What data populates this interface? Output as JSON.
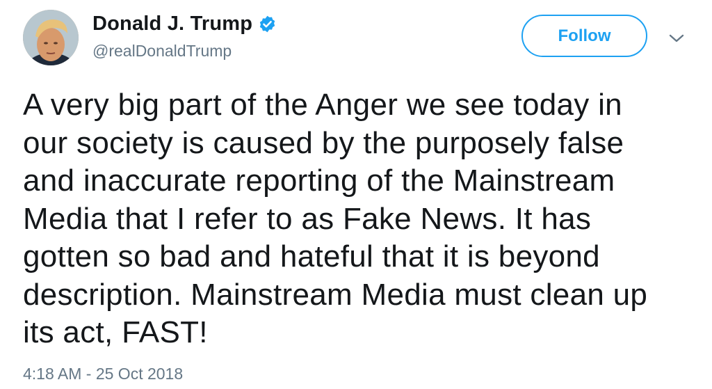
{
  "author": {
    "display_name": "Donald J. Trump",
    "handle": "@realDonaldTrump",
    "verified": true,
    "avatar": "profile-photo"
  },
  "actions": {
    "follow_label": "Follow",
    "more_menu_icon": "chevron-down-icon"
  },
  "tweet": {
    "text": "A very big part of the Anger we see today in\nour society is caused by the purposely false\nand inaccurate reporting of the Mainstream\nMedia that I refer to as Fake News. It has\ngotten so bad and hateful that it is beyond\ndescription. Mainstream Media must clean up\nits act, FAST!",
    "timestamp": "4:18 AM - 25 Oct 2018"
  },
  "colors": {
    "accent": "#1da1f2",
    "text_primary": "#14171a",
    "text_secondary": "#657786"
  }
}
